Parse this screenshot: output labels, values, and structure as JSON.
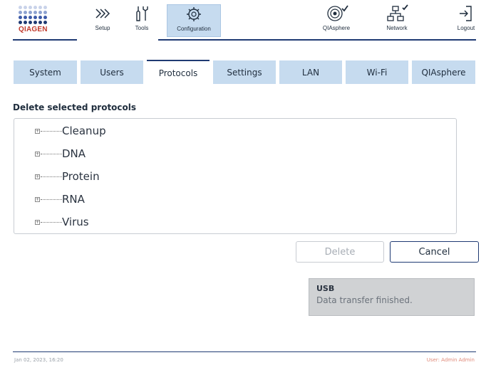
{
  "brand": {
    "name": "QIAGEN",
    "dot_colors": [
      "#c9d3ea",
      "#8ea2d0",
      "#3d5aa8",
      "#1f3a73"
    ]
  },
  "header": {
    "setup": {
      "label": "Setup",
      "icon": "chevrons-right-icon"
    },
    "tools": {
      "label": "Tools",
      "icon": "tools-icon"
    },
    "configuration": {
      "label": "Configuration",
      "icon": "gear-icon",
      "active": true
    },
    "qiasphere": {
      "label": "QIAsphere",
      "icon": "qiasphere-icon",
      "status": "connected"
    },
    "network": {
      "label": "Network",
      "icon": "network-icon",
      "status": "connected"
    },
    "logout": {
      "label": "Logout",
      "icon": "logout-icon"
    }
  },
  "tabs": [
    {
      "label": "System",
      "active": false
    },
    {
      "label": "Users",
      "active": false
    },
    {
      "label": "Protocols",
      "active": true
    },
    {
      "label": "Settings",
      "active": false
    },
    {
      "label": "LAN",
      "active": false
    },
    {
      "label": "Wi-Fi",
      "active": false
    },
    {
      "label": "QIAsphere",
      "active": false
    }
  ],
  "section_title": "Delete selected protocols",
  "tree": {
    "expander_symbol": "+",
    "items": [
      "Cleanup",
      "DNA",
      "Protein",
      "RNA",
      "Virus"
    ]
  },
  "actions": {
    "delete_label": "Delete",
    "delete_enabled": false,
    "cancel_label": "Cancel"
  },
  "notice": {
    "title": "USB",
    "message": "Data transfer finished."
  },
  "footer": {
    "datetime": "Jan 02, 2023, 16:20",
    "user": "User: Admin Admin"
  },
  "colors": {
    "accent": "#1f3a73",
    "tab_bg": "#c6dbef",
    "brand_red": "#c0392b"
  }
}
